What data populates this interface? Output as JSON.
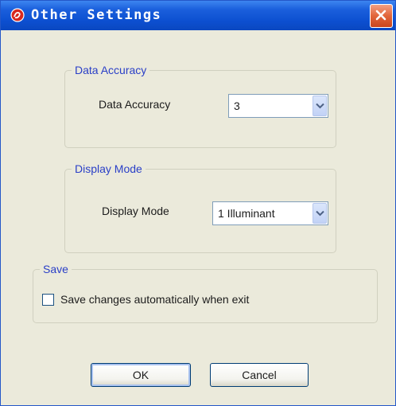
{
  "window": {
    "title": "Other Settings",
    "icon": "app-logo-icon",
    "close_icon": "close-icon"
  },
  "groups": {
    "data_accuracy": {
      "legend": "Data Accuracy",
      "label": "Data Accuracy",
      "value": "3"
    },
    "display_mode": {
      "legend": "Display Mode",
      "label": "Display Mode",
      "value": "1 Illuminant"
    },
    "save": {
      "legend": "Save",
      "checkbox_label": "Save changes automatically when exit",
      "checked": false
    }
  },
  "buttons": {
    "ok": "OK",
    "cancel": "Cancel"
  },
  "colors": {
    "titlebar": "#0c4fd0",
    "legend_text": "#2a3fc7",
    "close_button": "#e2653a",
    "dialog_bg": "#ebeadb"
  }
}
